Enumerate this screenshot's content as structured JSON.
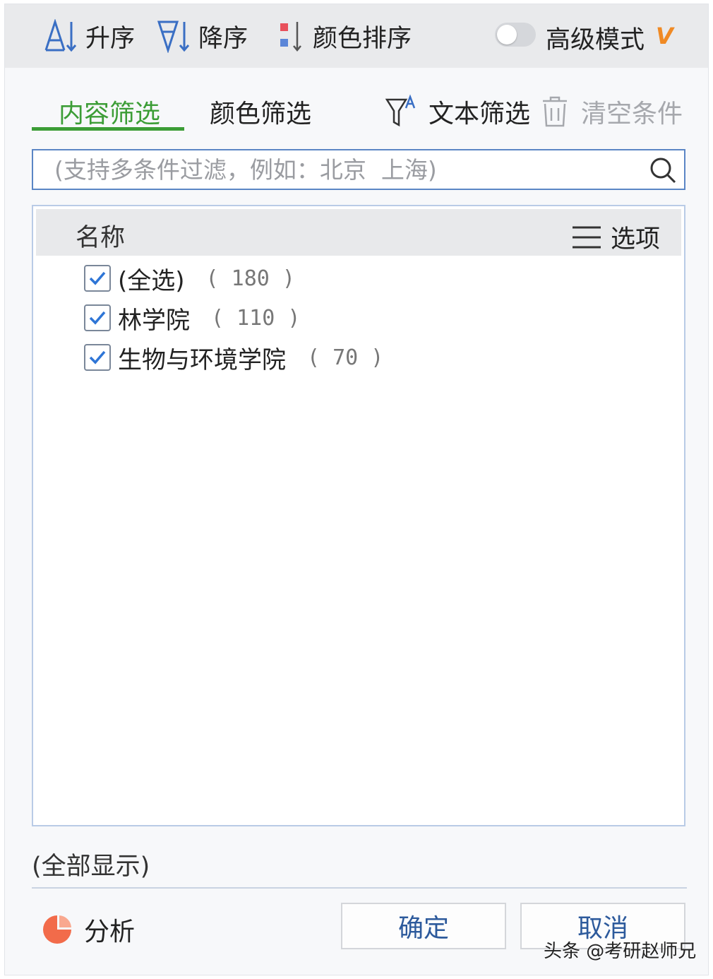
{
  "toolbar": {
    "sort_asc_label": "升序",
    "sort_desc_label": "降序",
    "color_sort_label": "颜色排序",
    "advanced_mode_label": "高级模式",
    "advanced_mode_on": false,
    "vip_badge": "V",
    "accent_color": "#3a6fc4",
    "vip_color": "#f08a24"
  },
  "tabs": [
    {
      "label": "内容筛选",
      "active": true
    },
    {
      "label": "颜色筛选",
      "active": false
    }
  ],
  "actions": {
    "text_filter_label": "文本筛选",
    "clear_label": "清空条件"
  },
  "search": {
    "placeholder": "(支持多条件过滤，例如：北京  上海)",
    "value": ""
  },
  "list": {
    "header_name": "名称",
    "options_label": "选项",
    "items": [
      {
        "label": "(全选)",
        "count": "( 180 )",
        "checked": true
      },
      {
        "label": "林学院",
        "count": "( 110 )",
        "checked": true
      },
      {
        "label": "生物与环境学院",
        "count": "( 70 )",
        "checked": true
      }
    ]
  },
  "footer": {
    "show_all_label": "(全部显示)",
    "analysis_label": "分析",
    "ok_label": "确定",
    "cancel_label": "取消",
    "analysis_icon_color": "#f26b4a"
  },
  "watermark": "头条 @考研赵师兄",
  "colors": {
    "active_tab": "#3c9d36",
    "checkbox_mark": "#2e75d6",
    "search_border": "#5b86c5"
  }
}
